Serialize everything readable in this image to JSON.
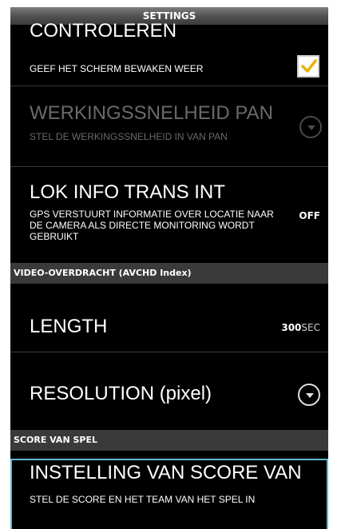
{
  "header": {
    "title": "SETTINGS"
  },
  "items": {
    "controleren": {
      "title": "CONTROLEREN",
      "description": "GEEF HET SCHERM BEWAKEN WEER",
      "checked": true
    },
    "werkingssnelheid": {
      "title": "WERKINGSSNELHEID PAN",
      "description": "STEL DE WERKINGSSNELHEID IN VAN PAN",
      "enabled": false
    },
    "lok_info": {
      "title": "LOK INFO TRANS INT",
      "description": "GPS VERSTUURT INFORMATIE OVER LOCATIE NAAR DE CAMERA ALS DIRECTE MONITORING WORDT GEBRUIKT",
      "value": "OFF"
    },
    "length": {
      "title": "LENGTH",
      "value": "300",
      "unit": "SEC"
    },
    "resolution": {
      "title": "RESOLUTION (pixel)"
    },
    "score_setting": {
      "title": "INSTELLING VAN SCORE VAN",
      "description": "STEL DE SCORE EN HET TEAM VAN HET SPEL IN"
    }
  },
  "sections": {
    "video_overdracht": "VIDEO-OVERDRACHT (AVCHD Index)",
    "score_van_spel": "SCORE VAN SPEL"
  },
  "colors": {
    "background": "#000000",
    "section_bg": "#3a3a3a",
    "highlight": "#5fb9d9",
    "check": "#e8b300",
    "disabled_text": "#6a6a6a"
  },
  "icons": [
    "checkmark-icon",
    "chevron-down-icon"
  ]
}
